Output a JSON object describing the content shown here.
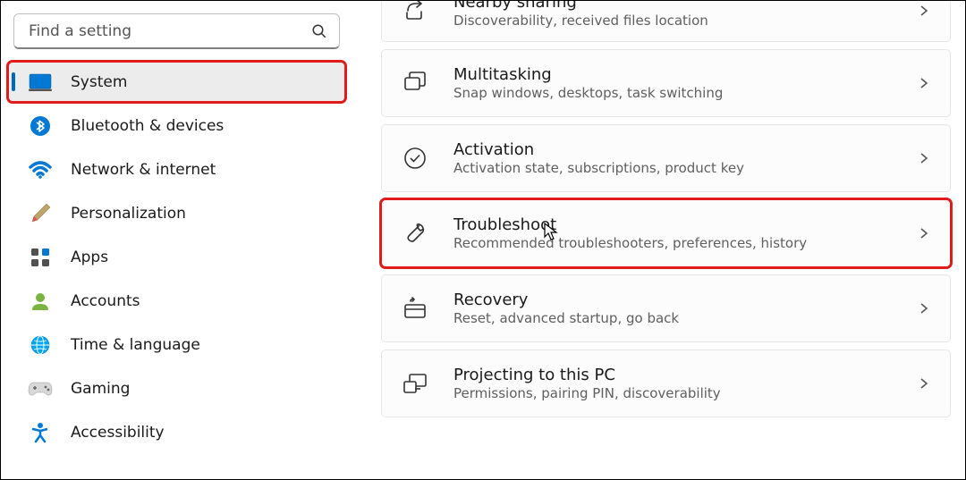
{
  "search": {
    "placeholder": "Find a setting"
  },
  "sidebar": [
    {
      "id": "system",
      "label": "System",
      "selected": true
    },
    {
      "id": "bluetooth",
      "label": "Bluetooth & devices"
    },
    {
      "id": "network",
      "label": "Network & internet"
    },
    {
      "id": "personalization",
      "label": "Personalization"
    },
    {
      "id": "apps",
      "label": "Apps"
    },
    {
      "id": "accounts",
      "label": "Accounts"
    },
    {
      "id": "time",
      "label": "Time & language"
    },
    {
      "id": "gaming",
      "label": "Gaming"
    },
    {
      "id": "accessibility",
      "label": "Accessibility"
    }
  ],
  "cards": [
    {
      "id": "nearby",
      "title": "Nearby sharing",
      "sub": "Discoverability, received files location"
    },
    {
      "id": "multitasking",
      "title": "Multitasking",
      "sub": "Snap windows, desktops, task switching"
    },
    {
      "id": "activation",
      "title": "Activation",
      "sub": "Activation state, subscriptions, product key"
    },
    {
      "id": "troubleshoot",
      "title": "Troubleshoot",
      "sub": "Recommended troubleshooters, preferences, history"
    },
    {
      "id": "recovery",
      "title": "Recovery",
      "sub": "Reset, advanced startup, go back"
    },
    {
      "id": "projecting",
      "title": "Projecting to this PC",
      "sub": "Permissions, pairing PIN, discoverability"
    }
  ]
}
